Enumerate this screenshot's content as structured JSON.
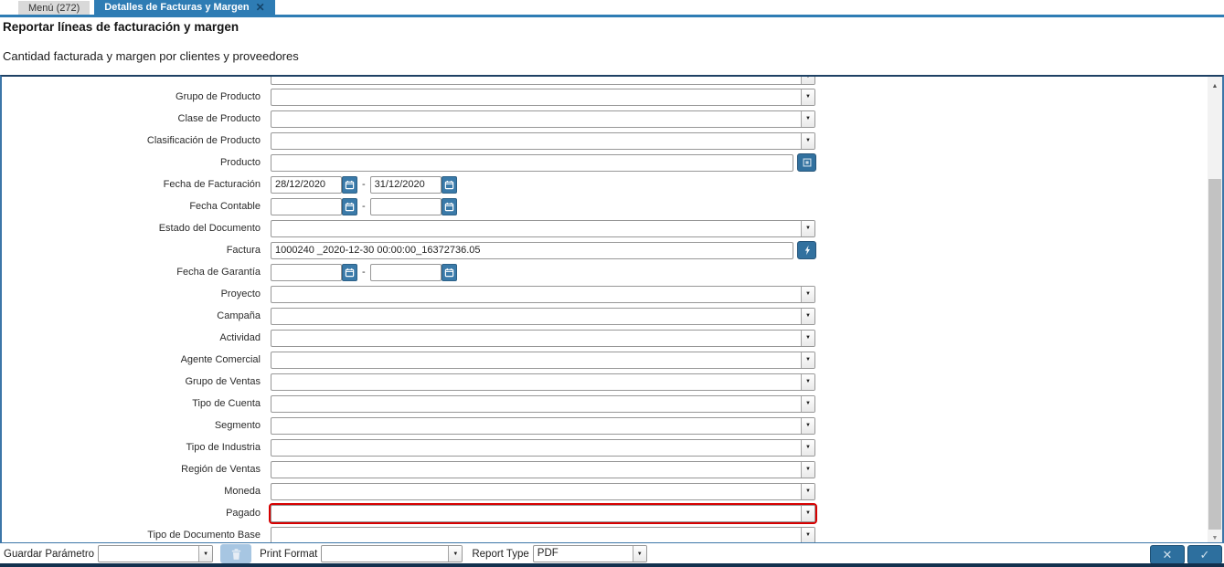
{
  "tabs": [
    {
      "label": "Menú (272)",
      "active": false
    },
    {
      "label": "Detalles de Facturas y Margen",
      "active": true
    }
  ],
  "header": {
    "title": "Reportar líneas de facturación y margen",
    "subtitle": "Cantidad facturada y margen por clientes y proveedores"
  },
  "form": {
    "rows": [
      {
        "type": "partial_select",
        "name": "fila-superior-cortada",
        "label": "",
        "value": ""
      },
      {
        "type": "select",
        "name": "grupo-de-producto",
        "label": "Grupo de Producto",
        "value": ""
      },
      {
        "type": "select",
        "name": "clase-de-producto",
        "label": "Clase de Producto",
        "value": ""
      },
      {
        "type": "select",
        "name": "clasificacion-de-producto",
        "label": "Clasificación de Producto",
        "value": ""
      },
      {
        "type": "lookup",
        "name": "producto",
        "label": "Producto",
        "value": "",
        "icon": "product-lookup-icon"
      },
      {
        "type": "daterange",
        "name": "fecha-de-facturacion",
        "label": "Fecha de Facturación",
        "from": "28/12/2020",
        "to": "31/12/2020"
      },
      {
        "type": "daterange",
        "name": "fecha-contable",
        "label": "Fecha Contable",
        "from": "",
        "to": ""
      },
      {
        "type": "select",
        "name": "estado-del-documento",
        "label": "Estado del Documento",
        "value": ""
      },
      {
        "type": "lookup",
        "name": "factura",
        "label": "Factura",
        "value": "1000240 _2020-12-30 00:00:00_16372736.05",
        "icon": "record-lookup-icon"
      },
      {
        "type": "daterange",
        "name": "fecha-de-garantia",
        "label": "Fecha de Garantía",
        "from": "",
        "to": ""
      },
      {
        "type": "select",
        "name": "proyecto",
        "label": "Proyecto",
        "value": ""
      },
      {
        "type": "select",
        "name": "campana",
        "label": "Campaña",
        "value": ""
      },
      {
        "type": "select",
        "name": "actividad",
        "label": "Actividad",
        "value": ""
      },
      {
        "type": "select",
        "name": "agente-comercial",
        "label": "Agente Comercial",
        "value": ""
      },
      {
        "type": "select",
        "name": "grupo-de-ventas",
        "label": "Grupo de Ventas",
        "value": ""
      },
      {
        "type": "select",
        "name": "tipo-de-cuenta",
        "label": "Tipo de Cuenta",
        "value": ""
      },
      {
        "type": "select",
        "name": "segmento",
        "label": "Segmento",
        "value": ""
      },
      {
        "type": "select",
        "name": "tipo-de-industria",
        "label": "Tipo de Industria",
        "value": ""
      },
      {
        "type": "select",
        "name": "region-de-ventas",
        "label": "Región de Ventas",
        "value": ""
      },
      {
        "type": "select",
        "name": "moneda",
        "label": "Moneda",
        "value": ""
      },
      {
        "type": "select",
        "name": "pagado",
        "label": "Pagado",
        "value": "",
        "highlight": true
      },
      {
        "type": "select",
        "name": "tipo-de-documento-base",
        "label": "Tipo de Documento Base",
        "value": ""
      }
    ]
  },
  "footer": {
    "guardar_label": "Guardar Parámetro",
    "guardar_value": "",
    "print_format_label": "Print Format",
    "print_format_value": "",
    "report_type_label": "Report Type",
    "report_type_value": "PDF"
  },
  "icons": {
    "close": "✕",
    "cancel": "✕",
    "check": "✓",
    "chevron_down": "▼",
    "scroll_up": "▲",
    "scroll_down": "▼",
    "range_dash": "-"
  },
  "colors": {
    "tab_active": "#2e7cb4",
    "tab_inactive": "#d9d9d9",
    "panel_border": "#3c76a8",
    "panel_border_top": "#1e4164",
    "button_blue": "#32719f",
    "calendar_button_blue": "#3a7aa9",
    "trash_button_blue": "#a7c6e2",
    "highlight_red": "#d60000",
    "bottom_strip": "#13314e"
  }
}
